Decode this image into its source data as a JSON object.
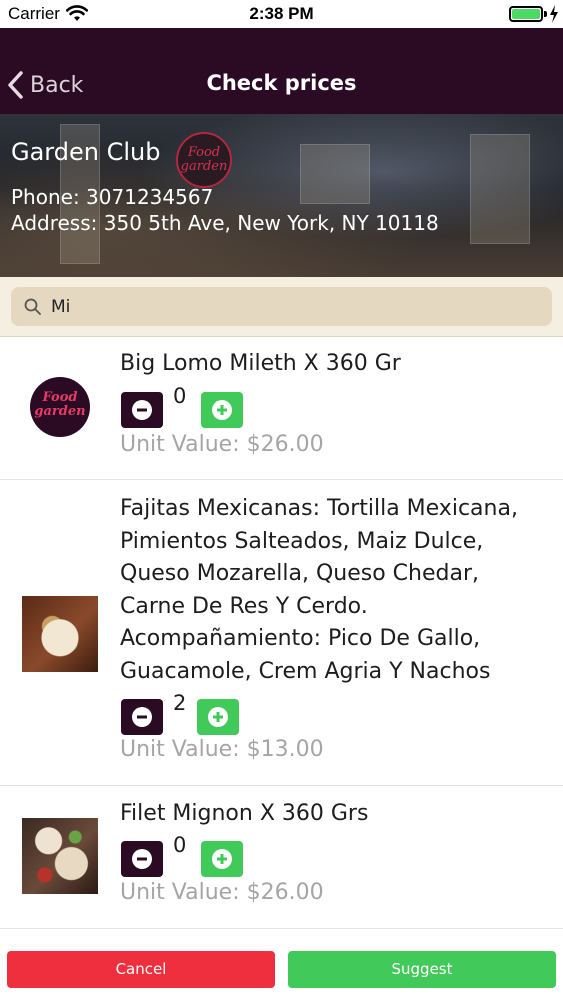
{
  "status_bar": {
    "carrier": "Carrier",
    "time": "2:38 PM",
    "wifi_icon": "wifi-icon",
    "battery_icon": "battery-icon",
    "charging_icon": "charging-bolt-icon"
  },
  "nav": {
    "back_label": "Back",
    "back_icon": "chevron-left-icon",
    "title": "Check prices"
  },
  "restaurant": {
    "name": "Garden Club",
    "phone": "Phone: 3071234567",
    "address": "Address: 350 5th Ave, New York, NY 10118",
    "logo_text": "Food garden"
  },
  "search": {
    "icon": "search-icon",
    "value": "Mi",
    "placeholder": ""
  },
  "products": [
    {
      "title": "Big Lomo Mileth X 360 Gr",
      "quantity": "0",
      "unit_value": "Unit Value: $26.00",
      "image": "restaurant-logo"
    },
    {
      "title": "Fajitas Mexicanas: Tortilla Mexicana, Pimientos Salteados, Maiz Dulce, Queso Mozarella, Queso Chedar, Carne De Res Y Cerdo. Acompañamiento: Pico De Gallo, Guacamole, Crem Agria Y Nachos",
      "quantity": "2",
      "unit_value": "Unit Value: $13.00",
      "image": "food-photo"
    },
    {
      "title": "Filet Mignon X 360 Grs",
      "quantity": "0",
      "unit_value": "Unit Value: $26.00",
      "image": "food-photo"
    }
  ],
  "footer": {
    "cancel_label": "Cancel",
    "suggest_label": "Suggest"
  },
  "colors": {
    "nav_background": "#2b0a24",
    "minus_button": "#2b0a24",
    "plus_button": "#41c95a",
    "cancel_button": "#ef2f3d",
    "suggest_button": "#41c95a",
    "unit_value_text": "#a5a5a5",
    "search_background": "#e4d9c0"
  }
}
